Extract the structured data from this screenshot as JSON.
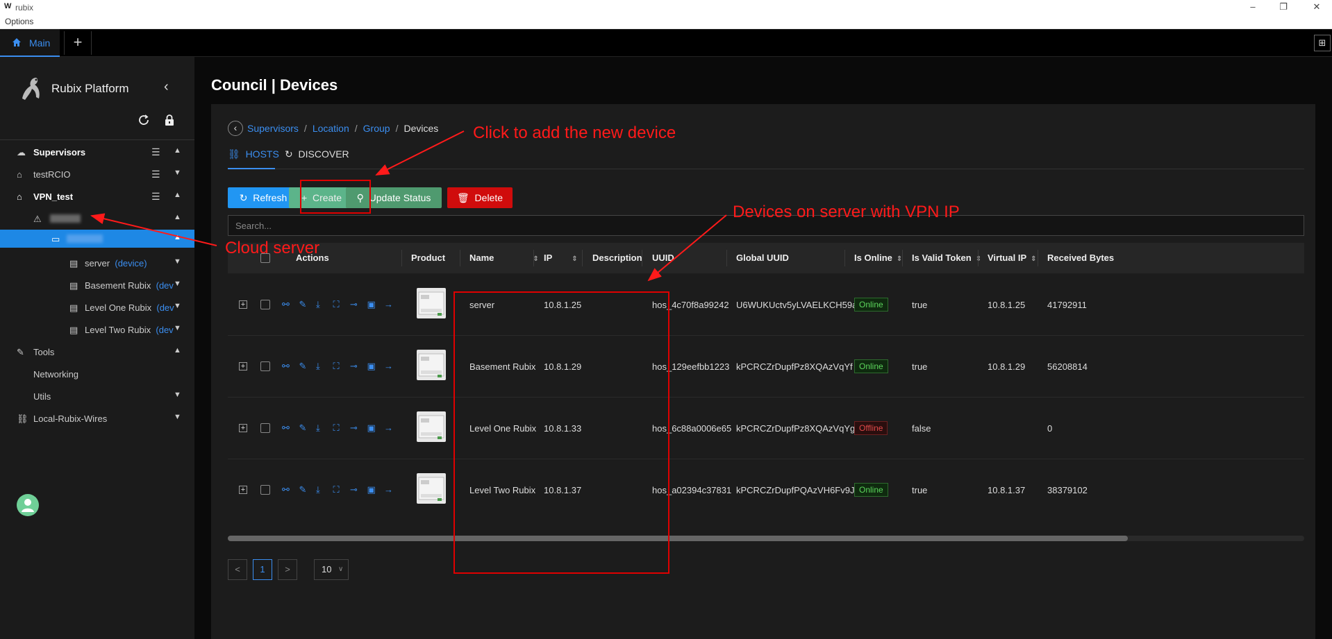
{
  "window": {
    "title": "rubix",
    "menu": "Options"
  },
  "tabs": {
    "main": "Main",
    "add": "+"
  },
  "sidebar": {
    "brand": "Rubix Platform",
    "items": [
      {
        "label": "Supervisors"
      },
      {
        "label": "testRCIO"
      },
      {
        "label": "VPN_test"
      },
      {
        "label": "server",
        "tag": "(device)"
      },
      {
        "label": "Basement Rubix",
        "tag": "(dev"
      },
      {
        "label": "Level One Rubix",
        "tag": "(dev"
      },
      {
        "label": "Level Two Rubix",
        "tag": "(dev"
      },
      {
        "label": "Tools"
      },
      {
        "label": "Networking"
      },
      {
        "label": "Utils"
      },
      {
        "label": "Local-Rubix-Wires"
      }
    ]
  },
  "page": {
    "title": "Council | Devices",
    "breadcrumb": [
      "Supervisors",
      "Location",
      "Group",
      "Devices"
    ],
    "tabs": [
      "HOSTS",
      "DISCOVER"
    ],
    "buttons": {
      "refresh": "Refresh",
      "create": "Create",
      "update": "Update Status",
      "delete": "Delete"
    },
    "search_placeholder": "Search..."
  },
  "table": {
    "headers": [
      "Actions",
      "Product",
      "Name",
      "IP",
      "Description",
      "UUID",
      "Global UUID",
      "Is Online",
      "Is Valid Token",
      "Virtual IP",
      "Received Bytes"
    ],
    "rows": [
      {
        "name": "server",
        "ip": "10.8.1.25",
        "uuid": "hos_4c70f8a99242",
        "global_uuid": "U6WUKUctv5yLVAELKCH59a",
        "online": "Online",
        "valid": "true",
        "vip": "10.8.1.25",
        "bytes": "41792911"
      },
      {
        "name": "Basement Rubix",
        "ip": "10.8.1.29",
        "uuid": "hos_129eefbb1223",
        "global_uuid": "kPCRCZrDupfPz8XQAzVqYf",
        "online": "Online",
        "valid": "true",
        "vip": "10.8.1.29",
        "bytes": "56208814"
      },
      {
        "name": "Level One Rubix",
        "ip": "10.8.1.33",
        "uuid": "hos_6c88a0006e65",
        "global_uuid": "kPCRCZrDupfPz8XQAzVqYg",
        "online": "Offline",
        "valid": "false",
        "vip": "",
        "bytes": "0"
      },
      {
        "name": "Level Two Rubix",
        "ip": "10.8.1.37",
        "uuid": "hos_a02394c37831",
        "global_uuid": "kPCRCZrDupfPQAzVH6Fv9J",
        "online": "Online",
        "valid": "true",
        "vip": "10.8.1.37",
        "bytes": "38379102"
      }
    ]
  },
  "pagination": {
    "current": "1",
    "page_size": "10",
    "prev": "<",
    "next": ">"
  },
  "annotations": {
    "create": "Click to add the new device",
    "devices": "Devices on server with VPN IP",
    "cloud": "Cloud server"
  },
  "colors": {
    "accent": "#3b8ef0",
    "annotation": "#ff1a1a",
    "online": "#5cd65c",
    "offline": "#e04a4a",
    "delete": "#d00c0c"
  }
}
